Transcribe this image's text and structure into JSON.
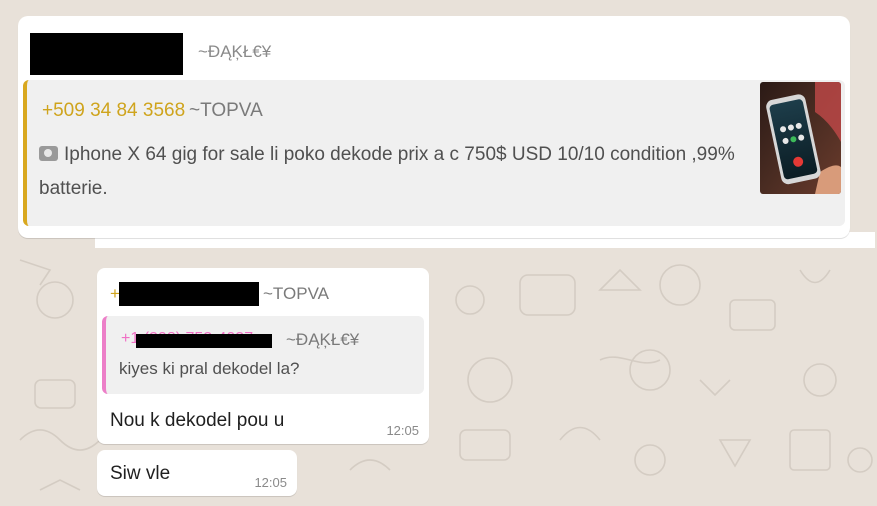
{
  "messages": [
    {
      "sender_handle": "~ĐĄĶŁ€¥",
      "quote": {
        "phone": "+509 34 84 3568",
        "handle": "~TOPVA",
        "icon": "camera-icon",
        "text": "Iphone X 64 gig for sale li poko dekode prix a c 750$ USD 10/10 condition ,99% batterie.",
        "has_thumbnail": true,
        "accent_color": "#d9a81f"
      }
    },
    {
      "sender_prefix": "+",
      "sender_handle": "~TOPVA",
      "quote": {
        "phone": "+1 (208) 752-4037",
        "handle": "~ĐĄĶŁ€¥",
        "text": "kiyes ki pral dekodel la?",
        "accent_color": "#ec7fc8"
      },
      "body": "Nou k dekodel pou u",
      "time": "12:05"
    },
    {
      "body": "Siw vle",
      "time": "12:05"
    }
  ]
}
